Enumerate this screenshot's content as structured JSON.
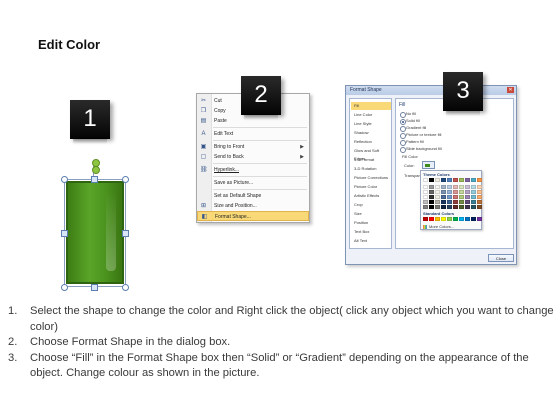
{
  "title": "Edit Color",
  "badges": [
    "1",
    "2",
    "3"
  ],
  "context_menu": {
    "items": [
      {
        "icon": "cut-icon",
        "glyph": "✂",
        "label": "Cut"
      },
      {
        "icon": "copy-icon",
        "glyph": "❐",
        "label": "Copy"
      },
      {
        "icon": "paste-icon",
        "glyph": "▤",
        "label": "Paste"
      },
      {
        "icon": "edit-text-icon",
        "glyph": "A",
        "label": "Edit Text"
      },
      {
        "icon": "bring-front-icon",
        "glyph": "▣",
        "label": "Bring to Front",
        "submenu": true
      },
      {
        "icon": "send-back-icon",
        "glyph": "▢",
        "label": "Send to Back",
        "submenu": true
      },
      {
        "icon": "hyperlink-icon",
        "glyph": "⛓",
        "label": "Hyperlink..."
      },
      {
        "icon": "save-picture-icon",
        "glyph": "",
        "label": "Save as Picture..."
      },
      {
        "icon": "default-shape-icon",
        "glyph": "",
        "label": "Set as Default Shape"
      },
      {
        "icon": "size-position-icon",
        "glyph": "⊞",
        "label": "Size and Position..."
      },
      {
        "icon": "format-shape-icon",
        "glyph": "◧",
        "label": "Format Shape..."
      }
    ]
  },
  "dialog": {
    "title": "Format Shape",
    "close_glyph": "✕",
    "nav": [
      "Fill",
      "Line Color",
      "Line Style",
      "Shadow",
      "Reflection",
      "Glow and Soft Edges",
      "3-D Format",
      "3-D Rotation",
      "Picture Corrections",
      "Picture Color",
      "Artistic Effects",
      "Crop",
      "Size",
      "Position",
      "Text Box",
      "Alt Text"
    ],
    "pane_heading": "Fill",
    "options": [
      "No fill",
      "Solid fill",
      "Gradient fill",
      "Picture or texture fill",
      "Pattern fill",
      "Slide background fill"
    ],
    "fill_color_label": "Fill Color",
    "color_label": "Color:",
    "transparency_label": "Transparency:",
    "palette": {
      "theme_heading": "Theme Colors",
      "standard_heading": "Standard Colors",
      "more_colors": "More Colors...",
      "theme_colors": [
        "#ffffff",
        "#000000",
        "#eeece1",
        "#1f497d",
        "#4f81bd",
        "#c0504d",
        "#9bbb59",
        "#8064a2",
        "#4bacc6",
        "#f79646"
      ],
      "standard_colors": [
        "#c00000",
        "#ff0000",
        "#ffc000",
        "#ffff00",
        "#92d050",
        "#00b050",
        "#00b0f0",
        "#0070c0",
        "#002060",
        "#7030a0"
      ]
    },
    "close_button": "Close"
  },
  "steps": [
    {
      "num": "1.",
      "text": "Select the shape to change the color and Right click the object( click any object which you want to change color)"
    },
    {
      "num": "2.",
      "text": "Choose Format Shape in the dialog box."
    },
    {
      "num": "3.",
      "text": "Choose “Fill” in the Format Shape box then “Solid” or “Gradient” depending on the appearance of the object. Change colour as shown in the picture."
    }
  ]
}
